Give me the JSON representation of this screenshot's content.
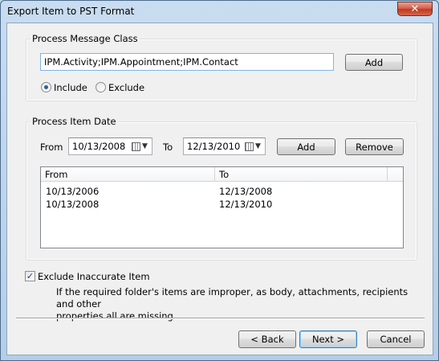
{
  "window": {
    "title": "Export Item to PST Format",
    "close_glyph": "✕"
  },
  "message_class": {
    "legend": "Process Message Class",
    "value": "IPM.Activity;IPM.Appointment;IPM.Contact",
    "add_label": "Add",
    "include_label": "Include",
    "exclude_label": "Exclude",
    "selected": "Include"
  },
  "item_date": {
    "legend": "Process Item Date",
    "from_label": "From",
    "from_value": "10/13/2008",
    "to_label": "To",
    "to_value": "12/13/2010",
    "add_label": "Add",
    "remove_label": "Remove",
    "columns": [
      "From",
      "To"
    ],
    "rows": [
      [
        "10/13/2006",
        "12/13/2008"
      ],
      [
        "10/13/2008",
        "12/13/2010"
      ]
    ]
  },
  "exclude_inaccurate": {
    "label": "Exclude Inaccurate Item",
    "checked": true,
    "check_glyph": "✓",
    "description_line1": "If the required folder's items are improper, as body, attachments, recipients and other",
    "description_line2": "properties all are missing."
  },
  "footer": {
    "back_label": "< Back",
    "next_label": "Next >",
    "cancel_label": "Cancel"
  },
  "icons": {
    "close": "close-icon",
    "calendar": "calendar-icon",
    "dropdown": "chevron-down-icon"
  }
}
